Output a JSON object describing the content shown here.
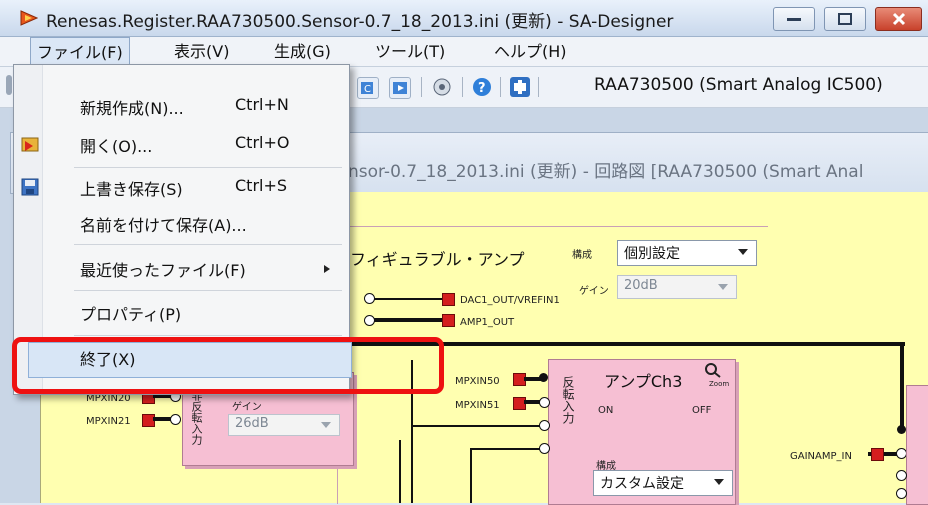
{
  "window": {
    "title": "Renesas.Register.RAA730500.Sensor-0.7_18_2013.ini (更新) - SA-Designer"
  },
  "colors": {
    "accent_red": "#ee1111",
    "schematic_bg": "#ffffb0",
    "block_pink": "#f6bfd3",
    "pin_red": "#d41e1e"
  },
  "menubar": {
    "items": [
      "ファイル(F)",
      "表示(V)",
      "生成(G)",
      "ツール(T)",
      "ヘルプ(H)"
    ]
  },
  "toolbar": {
    "device_label": "RAA730500 (Smart Analog IC500)"
  },
  "child_window": {
    "title": "nsor-0.7_18_2013.ini (更新) - 回路図 [RAA730500 (Smart Anal"
  },
  "file_menu": {
    "items": [
      {
        "label": "新規作成(N)...",
        "shortcut": "Ctrl+N",
        "icon": ""
      },
      {
        "label": "開く(O)...",
        "shortcut": "Ctrl+O",
        "icon": "open-folder-icon"
      },
      {
        "label": "上書き保存(S)",
        "shortcut": "Ctrl+S",
        "icon": "save-disk-icon"
      },
      {
        "label": "名前を付けて保存(A)...",
        "shortcut": "",
        "icon": ""
      },
      {
        "label": "最近使ったファイル(F)",
        "shortcut": "",
        "icon": "submenu-arrow-icon"
      },
      {
        "label": "プロパティ(P)",
        "shortcut": "",
        "icon": ""
      },
      {
        "label": "終了(X)",
        "shortcut": "",
        "icon": ""
      }
    ]
  },
  "schematic": {
    "amp_block_title": "フィギュラブル・アンプ",
    "config_label": "構成",
    "config_value": "個別設定",
    "gain_label": "ゲイン",
    "gain_value": "20dB",
    "net_dac": "DAC1_OUT/VREFIN1",
    "net_amp": "AMP1_OUT",
    "left_block": {
      "pins": [
        "MPXIN20",
        "MPXIN21"
      ],
      "vertical_label": "非反転入力",
      "gain_label": "ゲイン",
      "gain_value": "26dB"
    },
    "ch3_block": {
      "title": "アンプCh3",
      "zoom_label": "Zoom",
      "pins": [
        "MPXIN50",
        "MPXIN51"
      ],
      "vertical_label": "反転入力",
      "on_label": "ON",
      "off_label": "OFF",
      "config_label": "構成",
      "config_value": "カスタム設定"
    },
    "net_gainamp": "GAINAMP_IN"
  }
}
